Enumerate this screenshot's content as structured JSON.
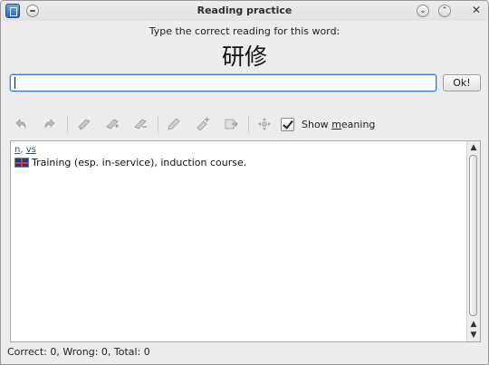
{
  "window": {
    "title": "Reading practice",
    "title_buttons": {
      "minimize": "⌄",
      "maximize": "⌃",
      "close": "✕"
    }
  },
  "header": {
    "prompt": "Type the correct reading for this word:",
    "word": "研修"
  },
  "answer": {
    "value": "",
    "placeholder": "",
    "ok_label": "Ok!"
  },
  "toolbar": {
    "icons": [
      "undo-icon",
      "redo-icon",
      "bookmark-icon",
      "bookmark-add-icon",
      "bookmark-remove-icon",
      "edit-icon",
      "edit-add-icon",
      "export-icon",
      "move-icon"
    ],
    "show_meaning": {
      "prefix": "Show ",
      "mnemonic": "m",
      "suffix": "eaning",
      "checked": true
    }
  },
  "meaning": {
    "pos_tags": [
      "n",
      "vs"
    ],
    "pos_separator": ", ",
    "definition": "Training (esp. in-service), induction course."
  },
  "status": {
    "text": "Correct: 0, Wrong: 0, Total: 0"
  },
  "colors": {
    "link": "#1d4f9c",
    "focus": "#3b7bd1",
    "window_bg": "#ececec"
  }
}
